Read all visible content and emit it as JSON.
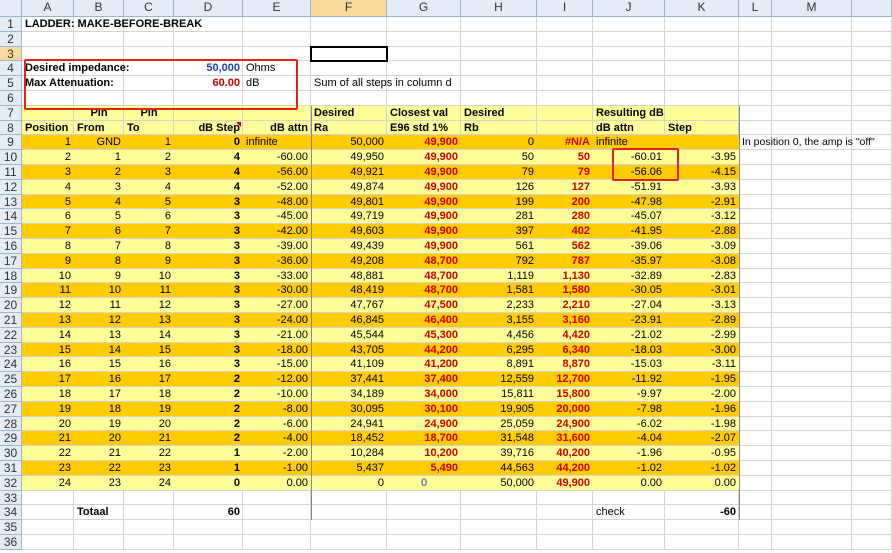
{
  "columns": [
    "A",
    "B",
    "C",
    "D",
    "E",
    "F",
    "G",
    "H",
    "I",
    "J",
    "K",
    "L",
    "M"
  ],
  "selected_column": "F",
  "selected_row": 3,
  "title": "LADDER: MAKE-BEFORE-BREAK",
  "inputs": {
    "impedance_label": "Desired impedance:",
    "impedance_value": "50,000",
    "impedance_unit": "Ohms",
    "attenuation_label": "Max Attenuation:",
    "attenuation_value": "60.00",
    "attenuation_unit": "dB",
    "note": "Sum of all steps in column d"
  },
  "headers": {
    "row7": {
      "B": "Pin",
      "C": "Pin",
      "F": "Desired",
      "G": "Closest val",
      "H": "Desired",
      "J": "Resulting dB"
    },
    "row8": {
      "A": "Position",
      "B": "From",
      "C": "To",
      "D": "dB Step",
      "E": "dB attn",
      "F": "Ra",
      "G": "E96 std 1%",
      "H": "Rb",
      "J": "dB attn",
      "K": "Step"
    }
  },
  "table": [
    {
      "row": 9,
      "pos": "1",
      "from": "GND",
      "to": "1",
      "step": "0",
      "attn": "infinite",
      "ra": "50,000",
      "e96": "49,900",
      "rb": "0",
      "ires": "#N/A",
      "jattn": "infinite",
      "kstep": ""
    },
    {
      "row": 10,
      "pos": "2",
      "from": "1",
      "to": "2",
      "step": "4",
      "attn": "-60.00",
      "ra": "49,950",
      "e96": "49,900",
      "rb": "50",
      "ires": "50",
      "jattn": "-60.01",
      "kstep": "-3.95"
    },
    {
      "row": 11,
      "pos": "3",
      "from": "2",
      "to": "3",
      "step": "4",
      "attn": "-56.00",
      "ra": "49,921",
      "e96": "49,900",
      "rb": "79",
      "ires": "79",
      "jattn": "-56.06",
      "kstep": "-4.15"
    },
    {
      "row": 12,
      "pos": "4",
      "from": "3",
      "to": "4",
      "step": "4",
      "attn": "-52.00",
      "ra": "49,874",
      "e96": "49,900",
      "rb": "126",
      "ires": "127",
      "jattn": "-51.91",
      "kstep": "-3.93"
    },
    {
      "row": 13,
      "pos": "5",
      "from": "4",
      "to": "5",
      "step": "3",
      "attn": "-48.00",
      "ra": "49,801",
      "e96": "49,900",
      "rb": "199",
      "ires": "200",
      "jattn": "-47.98",
      "kstep": "-2.91"
    },
    {
      "row": 14,
      "pos": "6",
      "from": "5",
      "to": "6",
      "step": "3",
      "attn": "-45.00",
      "ra": "49,719",
      "e96": "49,900",
      "rb": "281",
      "ires": "280",
      "jattn": "-45.07",
      "kstep": "-3.12"
    },
    {
      "row": 15,
      "pos": "7",
      "from": "6",
      "to": "7",
      "step": "3",
      "attn": "-42.00",
      "ra": "49,603",
      "e96": "49,900",
      "rb": "397",
      "ires": "402",
      "jattn": "-41.95",
      "kstep": "-2.88"
    },
    {
      "row": 16,
      "pos": "8",
      "from": "7",
      "to": "8",
      "step": "3",
      "attn": "-39.00",
      "ra": "49,439",
      "e96": "49,900",
      "rb": "561",
      "ires": "562",
      "jattn": "-39.06",
      "kstep": "-3.09"
    },
    {
      "row": 17,
      "pos": "9",
      "from": "8",
      "to": "9",
      "step": "3",
      "attn": "-36.00",
      "ra": "49,208",
      "e96": "48,700",
      "rb": "792",
      "ires": "787",
      "jattn": "-35.97",
      "kstep": "-3.08"
    },
    {
      "row": 18,
      "pos": "10",
      "from": "9",
      "to": "10",
      "step": "3",
      "attn": "-33.00",
      "ra": "48,881",
      "e96": "48,700",
      "rb": "1,119",
      "ires": "1,130",
      "jattn": "-32.89",
      "kstep": "-2.83"
    },
    {
      "row": 19,
      "pos": "11",
      "from": "10",
      "to": "11",
      "step": "3",
      "attn": "-30.00",
      "ra": "48,419",
      "e96": "48,700",
      "rb": "1,581",
      "ires": "1,580",
      "jattn": "-30.05",
      "kstep": "-3.01"
    },
    {
      "row": 20,
      "pos": "12",
      "from": "11",
      "to": "12",
      "step": "3",
      "attn": "-27.00",
      "ra": "47,767",
      "e96": "47,500",
      "rb": "2,233",
      "ires": "2,210",
      "jattn": "-27.04",
      "kstep": "-3.13"
    },
    {
      "row": 21,
      "pos": "13",
      "from": "12",
      "to": "13",
      "step": "3",
      "attn": "-24.00",
      "ra": "46,845",
      "e96": "46,400",
      "rb": "3,155",
      "ires": "3,160",
      "jattn": "-23.91",
      "kstep": "-2.89"
    },
    {
      "row": 22,
      "pos": "14",
      "from": "13",
      "to": "14",
      "step": "3",
      "attn": "-21.00",
      "ra": "45,544",
      "e96": "45,300",
      "rb": "4,456",
      "ires": "4,420",
      "jattn": "-21.02",
      "kstep": "-2.99"
    },
    {
      "row": 23,
      "pos": "15",
      "from": "14",
      "to": "15",
      "step": "3",
      "attn": "-18.00",
      "ra": "43,705",
      "e96": "44,200",
      "rb": "6,295",
      "ires": "6,340",
      "jattn": "-18.03",
      "kstep": "-3.00"
    },
    {
      "row": 24,
      "pos": "16",
      "from": "15",
      "to": "16",
      "step": "3",
      "attn": "-15.00",
      "ra": "41,109",
      "e96": "41,200",
      "rb": "8,891",
      "ires": "8,870",
      "jattn": "-15.03",
      "kstep": "-3.11"
    },
    {
      "row": 25,
      "pos": "17",
      "from": "16",
      "to": "17",
      "step": "2",
      "attn": "-12.00",
      "ra": "37,441",
      "e96": "37,400",
      "rb": "12,559",
      "ires": "12,700",
      "jattn": "-11.92",
      "kstep": "-1.95"
    },
    {
      "row": 26,
      "pos": "18",
      "from": "17",
      "to": "18",
      "step": "2",
      "attn": "-10.00",
      "ra": "34,189",
      "e96": "34,000",
      "rb": "15,811",
      "ires": "15,800",
      "jattn": "-9.97",
      "kstep": "-2.00"
    },
    {
      "row": 27,
      "pos": "19",
      "from": "18",
      "to": "19",
      "step": "2",
      "attn": "-8.00",
      "ra": "30,095",
      "e96": "30,100",
      "rb": "19,905",
      "ires": "20,000",
      "jattn": "-7.98",
      "kstep": "-1.96"
    },
    {
      "row": 28,
      "pos": "20",
      "from": "19",
      "to": "20",
      "step": "2",
      "attn": "-6.00",
      "ra": "24,941",
      "e96": "24,900",
      "rb": "25,059",
      "ires": "24,900",
      "jattn": "-6.02",
      "kstep": "-1.98"
    },
    {
      "row": 29,
      "pos": "21",
      "from": "20",
      "to": "21",
      "step": "2",
      "attn": "-4.00",
      "ra": "18,452",
      "e96": "18,700",
      "rb": "31,548",
      "ires": "31,600",
      "jattn": "-4.04",
      "kstep": "-2.07"
    },
    {
      "row": 30,
      "pos": "22",
      "from": "21",
      "to": "22",
      "step": "1",
      "attn": "-2.00",
      "ra": "10,284",
      "e96": "10,200",
      "rb": "39,716",
      "ires": "40,200",
      "jattn": "-1.96",
      "kstep": "-0.95"
    },
    {
      "row": 31,
      "pos": "23",
      "from": "22",
      "to": "23",
      "step": "1",
      "attn": "-1.00",
      "ra": "5,437",
      "e96": "5,490",
      "rb": "44,563",
      "ires": "44,200",
      "jattn": "-1.02",
      "kstep": "-1.02"
    },
    {
      "row": 32,
      "pos": "24",
      "from": "23",
      "to": "24",
      "step": "0",
      "attn": "0.00",
      "ra": "0",
      "e96": "0",
      "rb": "50,000",
      "ires": "49,900",
      "jattn": "0.00",
      "kstep": "0.00"
    }
  ],
  "total_label": "Totaal",
  "total_value": "60",
  "check_label": "check",
  "check_value": "-60",
  "position0_note": "In position 0, the amp is \"off\"",
  "colors": {
    "yellow_light": "#ffff99",
    "yellow_dark": "#ffcc00",
    "red_text": "#d00000",
    "highlight_box": "#e0241a"
  }
}
